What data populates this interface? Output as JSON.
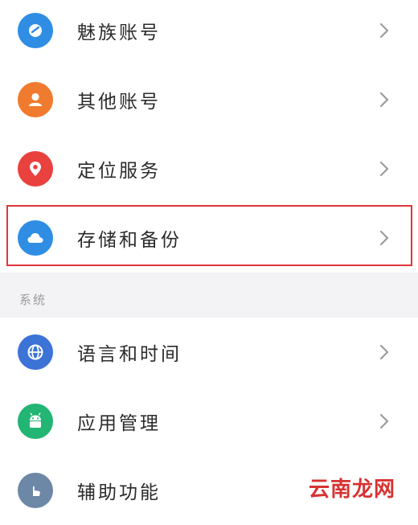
{
  "settings": {
    "items": [
      {
        "label": "魅族账号",
        "icon": "meizu-account-icon",
        "color": "#2f8de4"
      },
      {
        "label": "其他账号",
        "icon": "user-icon",
        "color": "#f07b2f"
      },
      {
        "label": "定位服务",
        "icon": "location-pin-icon",
        "color": "#e9413e"
      },
      {
        "label": "存储和备份",
        "icon": "cloud-icon",
        "color": "#2f8de4"
      },
      {
        "label": "语言和时间",
        "icon": "globe-icon",
        "color": "#3b73d6"
      },
      {
        "label": "应用管理",
        "icon": "android-icon",
        "color": "#22b573"
      },
      {
        "label": "辅助功能",
        "icon": "hand-icon",
        "color": "#6d87a6"
      }
    ],
    "section_title": "系统"
  },
  "watermark": {
    "text": "云南龙网"
  },
  "colors": {
    "highlight": "#e0353a",
    "section_bg": "#f3f3f5",
    "chevron": "#9b9b9b"
  }
}
